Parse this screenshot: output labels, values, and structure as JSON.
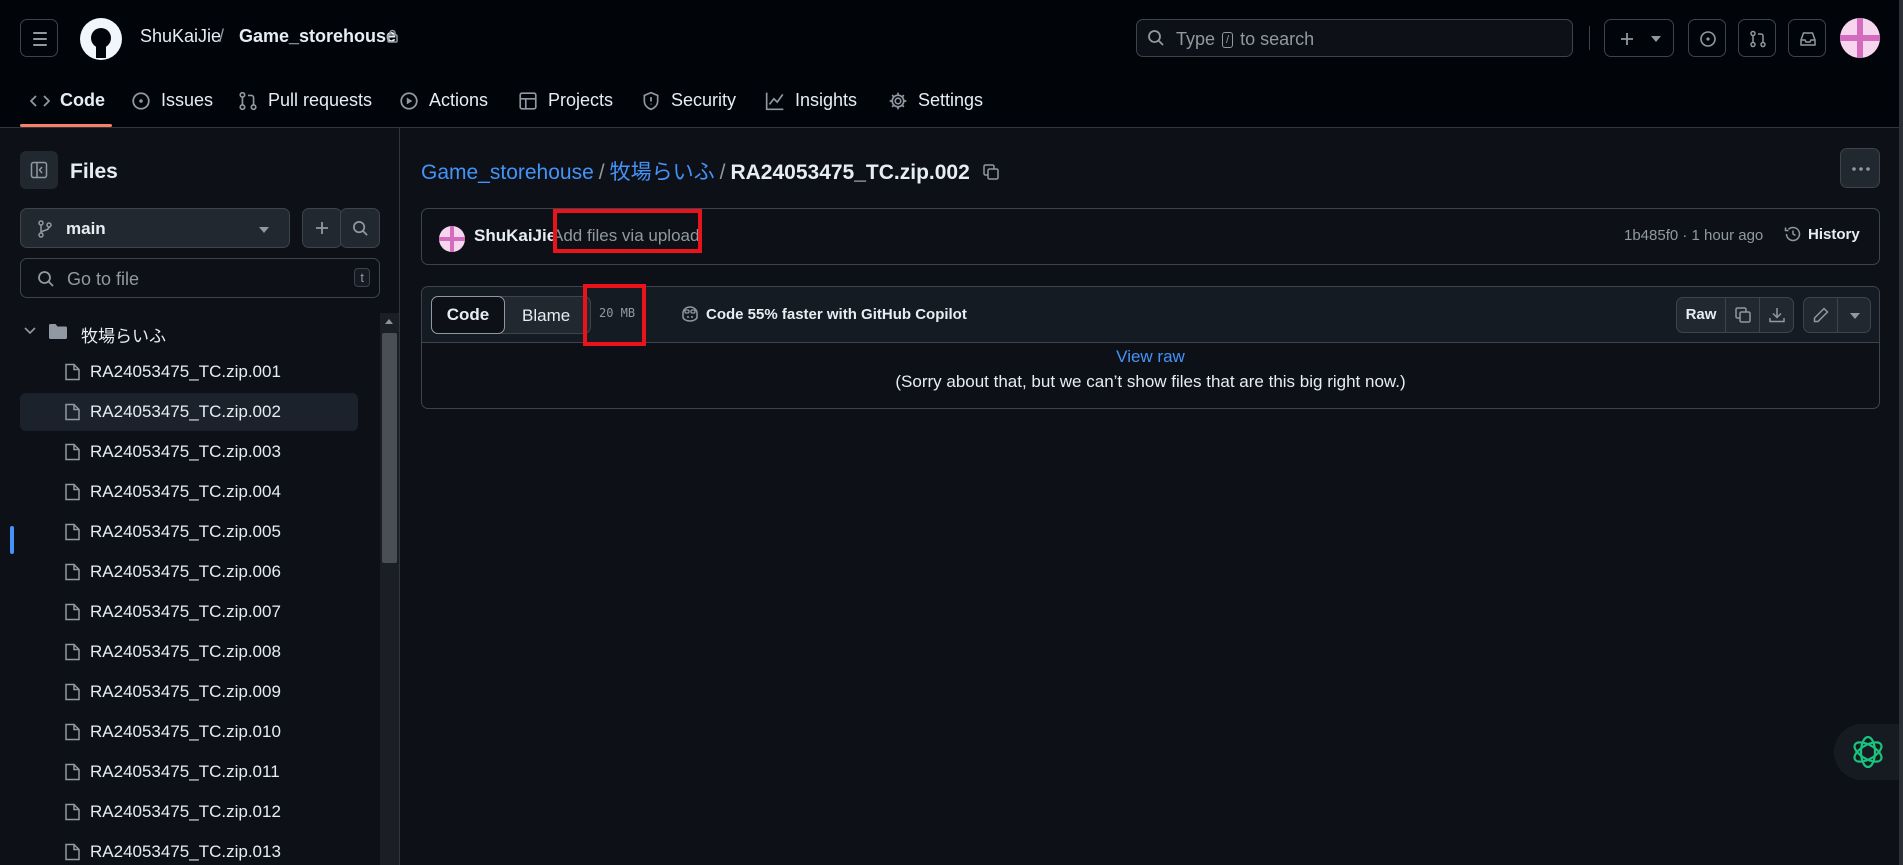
{
  "header": {
    "owner": "ShuKaiJie",
    "separator": "/",
    "repo": "Game_storehouse",
    "search_prefix": "Type",
    "search_key": "/",
    "search_suffix": "to search",
    "plus_label": "+"
  },
  "nav": {
    "items": [
      {
        "label": "Code",
        "icon": "code-icon"
      },
      {
        "label": "Issues",
        "icon": "issue-icon"
      },
      {
        "label": "Pull requests",
        "icon": "pull-request-icon"
      },
      {
        "label": "Actions",
        "icon": "play-icon"
      },
      {
        "label": "Projects",
        "icon": "table-icon"
      },
      {
        "label": "Security",
        "icon": "shield-icon"
      },
      {
        "label": "Insights",
        "icon": "graph-icon"
      },
      {
        "label": "Settings",
        "icon": "gear-icon"
      }
    ]
  },
  "sidebar": {
    "title": "Files",
    "branch": "main",
    "goto_placeholder": "Go to file",
    "goto_key": "t",
    "folder": "牧場らいふ",
    "files": [
      "RA24053475_TC.zip.001",
      "RA24053475_TC.zip.002",
      "RA24053475_TC.zip.003",
      "RA24053475_TC.zip.004",
      "RA24053475_TC.zip.005",
      "RA24053475_TC.zip.006",
      "RA24053475_TC.zip.007",
      "RA24053475_TC.zip.008",
      "RA24053475_TC.zip.009",
      "RA24053475_TC.zip.010",
      "RA24053475_TC.zip.011",
      "RA24053475_TC.zip.012",
      "RA24053475_TC.zip.013"
    ],
    "selected_index": 1
  },
  "breadcrumb": {
    "repo": "Game_storehouse",
    "sep": "/",
    "folder": "牧場らいふ",
    "file": "RA24053475_TC.zip.002"
  },
  "commit": {
    "author": "ShuKaiJie",
    "message": "Add files via upload",
    "meta": "1b485f0 · 1 hour ago",
    "history": "History"
  },
  "file": {
    "tab_code": "Code",
    "tab_blame": "Blame",
    "size": "20 MB",
    "copilot": "Code 55% faster with GitHub Copilot",
    "raw": "Raw",
    "view_raw": "View raw",
    "notice": "(Sorry about that, but we can’t show files that are this big right now.)"
  },
  "colors": {
    "background": "#0d1117",
    "link": "#4493f8",
    "active_tab": "#f78166",
    "highlight": "#e8131b"
  }
}
